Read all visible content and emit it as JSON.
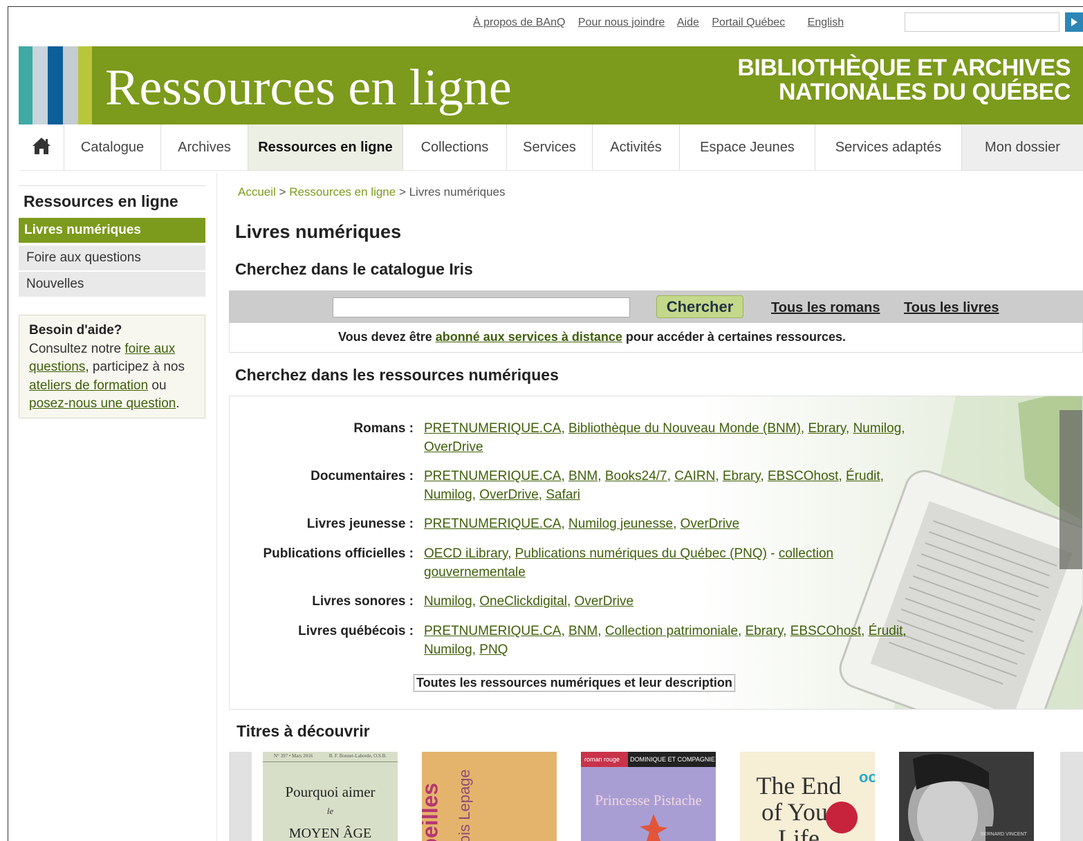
{
  "utility": {
    "links": [
      "À propos de BAnQ",
      "Pour nous joindre",
      "Aide",
      "Portail Québec"
    ],
    "english": "English"
  },
  "banner": {
    "title": "Ressources en ligne",
    "org_line1": "BIBLIOTHÈQUE ET ARCHIVES",
    "org_line2": "NATIONALES DU QUÉBEC"
  },
  "nav": {
    "items": [
      "Catalogue",
      "Archives",
      "Ressources en ligne",
      "Collections",
      "Services",
      "Activités",
      "Espace Jeunes",
      "Services adaptés",
      "Mon dossier"
    ]
  },
  "sidebar": {
    "title": "Ressources en ligne",
    "items": [
      "Livres numériques",
      "Foire aux questions",
      "Nouvelles"
    ],
    "help": {
      "title": "Besoin d'aide?",
      "t1": "Consultez notre ",
      "l1a": "foire aux",
      "l1b": "questions",
      "t2": ", participez à nos",
      "l2": "ateliers de formation",
      "t3": " ou",
      "l3": "posez-nous une question",
      "t4": "."
    }
  },
  "breadcrumb": {
    "home": "Accueil",
    "sep": " > ",
    "parent": "Ressources en ligne",
    "current": "Livres numériques"
  },
  "content": {
    "title": "Livres numériques",
    "catalog_heading": "Cherchez dans le catalogue Iris",
    "search_button": "Chercher",
    "link_novels": "Tous les romans",
    "link_books": "Tous les livres",
    "notice_pre": "Vous devez être ",
    "notice_link": "abonné aux services à distance",
    "notice_post": " pour accéder à certaines ressources.",
    "digital_heading": "Cherchez dans les ressources numériques",
    "resources": [
      {
        "label": "Romans :",
        "line1": [
          "PRETNUMERIQUE.CA",
          "Bibliothèque du Nouveau Monde (BNM)",
          "Ebrary",
          "Numilog"
        ],
        "line2": [
          "OverDrive"
        ]
      },
      {
        "label": "Documentaires :",
        "line1": [
          "PRETNUMERIQUE.CA",
          "BNM",
          "Books24/7",
          "CAIRN",
          "Ebrary",
          "EBSCOhost",
          "Érudit"
        ],
        "line2": [
          "Numilog",
          "OverDrive",
          "Safari"
        ]
      },
      {
        "label": "Livres jeunesse :",
        "line1": [
          "PRETNUMERIQUE.CA",
          "Numilog jeunesse",
          "OverDrive"
        ],
        "line2": []
      },
      {
        "label": "Publications officielles :",
        "line1": [
          "OECD iLibrary",
          "Publications numériques du Québec (PNQ)",
          "collection"
        ],
        "line2": [
          "gouvernementale"
        ]
      },
      {
        "label": "Livres sonores :",
        "line1": [
          "Numilog",
          "OneClickdigital",
          "OverDrive"
        ],
        "line2": []
      },
      {
        "label": "Livres québécois :",
        "line1": [
          "PRETNUMERIQUE.CA",
          "BNM",
          "Collection patrimoniale",
          "Ebrary",
          "EBSCOhost",
          "Érudit"
        ],
        "line2": [
          "Numilog",
          "PNQ"
        ]
      }
    ],
    "all_resources": "Toutes les ressources numériques et leur description",
    "discover_heading": "Titres à découvrir",
    "covers": {
      "c1_top_left": "N° 397 • Mars 2016",
      "c1_top_right": "B. F. Bonnet-Laborde, O.S.B.",
      "c1_line1": "Pourquoi aimer",
      "c1_line2": "le",
      "c1_line3": "MOYEN ÂGE",
      "c2_word": "beilles",
      "c2_author": "ois Lepage",
      "c3_tag": "roman rouge",
      "c3_series": "DOMINIQUE ET COMPAGNIE",
      "c3_title": "Princesse Pistache",
      "c4_line1": "The End",
      "c4_line2": "of Your",
      "c4_line3": "Life",
      "c4_badge": "oo",
      "c5_author": "BERNARD VINCENT"
    }
  },
  "colors": {
    "brand_green": "#7c9a1c",
    "link_green": "#3f5f0a"
  }
}
